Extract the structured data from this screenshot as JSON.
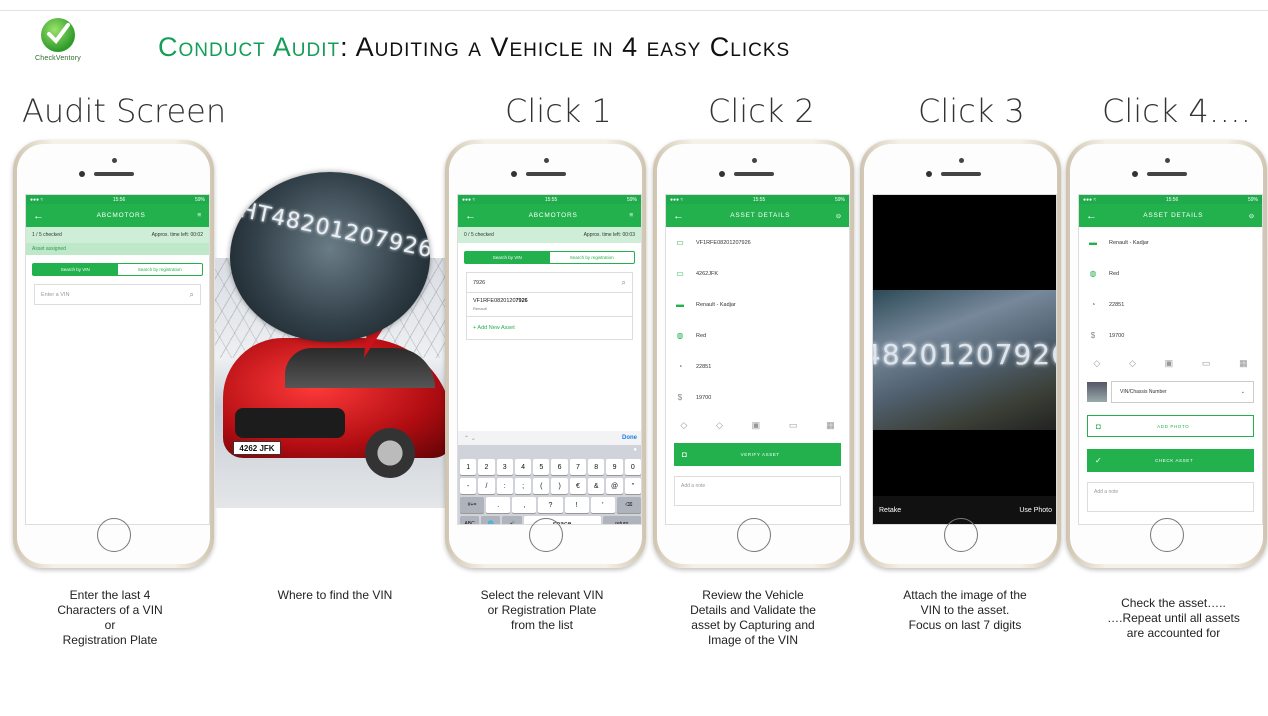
{
  "header": {
    "logo_text": "CheckVentory",
    "title_green": "Conduct Audit",
    "title_rest": ": Auditing a Vehicle in 4 easy Clicks"
  },
  "columns": {
    "audit": "Audit Screen",
    "click1": "Click 1",
    "click2": "Click 2",
    "click3": "Click 3",
    "click4": "Click 4…."
  },
  "status_bar": {
    "p1_time": "15:56",
    "p2_time": "15:55",
    "p3_time": "15:55",
    "p5_time": "15:56",
    "battery": "59%"
  },
  "audit_screen": {
    "title": "ABCMOTORS",
    "checked": "1 / 5 checked",
    "time_left": "Approx. time left: 00:02",
    "assigned": "Asset assigned",
    "tab_vin": "Search by VIN",
    "tab_reg": "Search by registration",
    "input_placeholder": "Enter a VIN"
  },
  "click1_screen": {
    "title": "ABCMOTORS",
    "checked": "0 / 5 checked",
    "time_left": "Approx. time left: 00:03",
    "tab_vin": "Search by VIN",
    "tab_reg": "Search by registration",
    "input_value": "7926",
    "result_vin_prefix": "VF1RFE0820120",
    "result_vin_match": "7926",
    "result_make": "Renault",
    "add_new": "+ Add New Asset",
    "done": "Done",
    "keys_row1": [
      "1",
      "2",
      "3",
      "4",
      "5",
      "6",
      "7",
      "8",
      "9",
      "0"
    ],
    "keys_row2": [
      "-",
      "/",
      ":",
      ";",
      "(",
      ")",
      "€",
      "&",
      "@",
      "\""
    ],
    "keys_row3": [
      "#+=",
      ".",
      ",",
      "?",
      "!",
      "'",
      "⌫"
    ],
    "keys_row4": [
      "ABC",
      "🌐",
      "🎤",
      "space",
      "return"
    ]
  },
  "click2_screen": {
    "title": "ASSET DETAILS",
    "vin": "VF1RFE08201207926",
    "registration": "4262JFK",
    "model": "Renault - Kadjar",
    "colour": "Red",
    "mileage": "22851",
    "price": "19700",
    "verify": "VERIFY ASSET",
    "note": "Add a note"
  },
  "click3_screen": {
    "digits": "48201207926",
    "retake": "Retake",
    "use_photo": "Use Photo"
  },
  "click4_screen": {
    "title": "ASSET DETAILS",
    "model": "Renault - Kadjar",
    "colour": "Red",
    "mileage": "22851",
    "price": "19700",
    "select": "VIN/Chassis Number",
    "add_photo": "ADD PHOTO",
    "check": "CHECK ASSET",
    "note": "Add a note"
  },
  "car_photo": {
    "plate": "4262 JFK",
    "zoom_digits": "HT48201207926"
  },
  "captions": {
    "c1": [
      "Enter the last 4",
      "Characters of a VIN",
      "or",
      "Registration Plate"
    ],
    "c2": [
      "Where to find the VIN"
    ],
    "c3": [
      "Select the relevant VIN",
      "or Registration Plate",
      "from the list"
    ],
    "c4": [
      "Review the Vehicle",
      "Details and Validate the",
      "asset by Capturing and",
      "Image of the VIN"
    ],
    "c5": [
      "Attach the image of the",
      "VIN to the asset.",
      "Focus on last 7 digits"
    ],
    "c6": [
      "Check the asset…..",
      "….Repeat until all assets",
      "are accounted for"
    ]
  },
  "colors": {
    "brand_green": "#22b14c",
    "title_green": "#149e58"
  }
}
